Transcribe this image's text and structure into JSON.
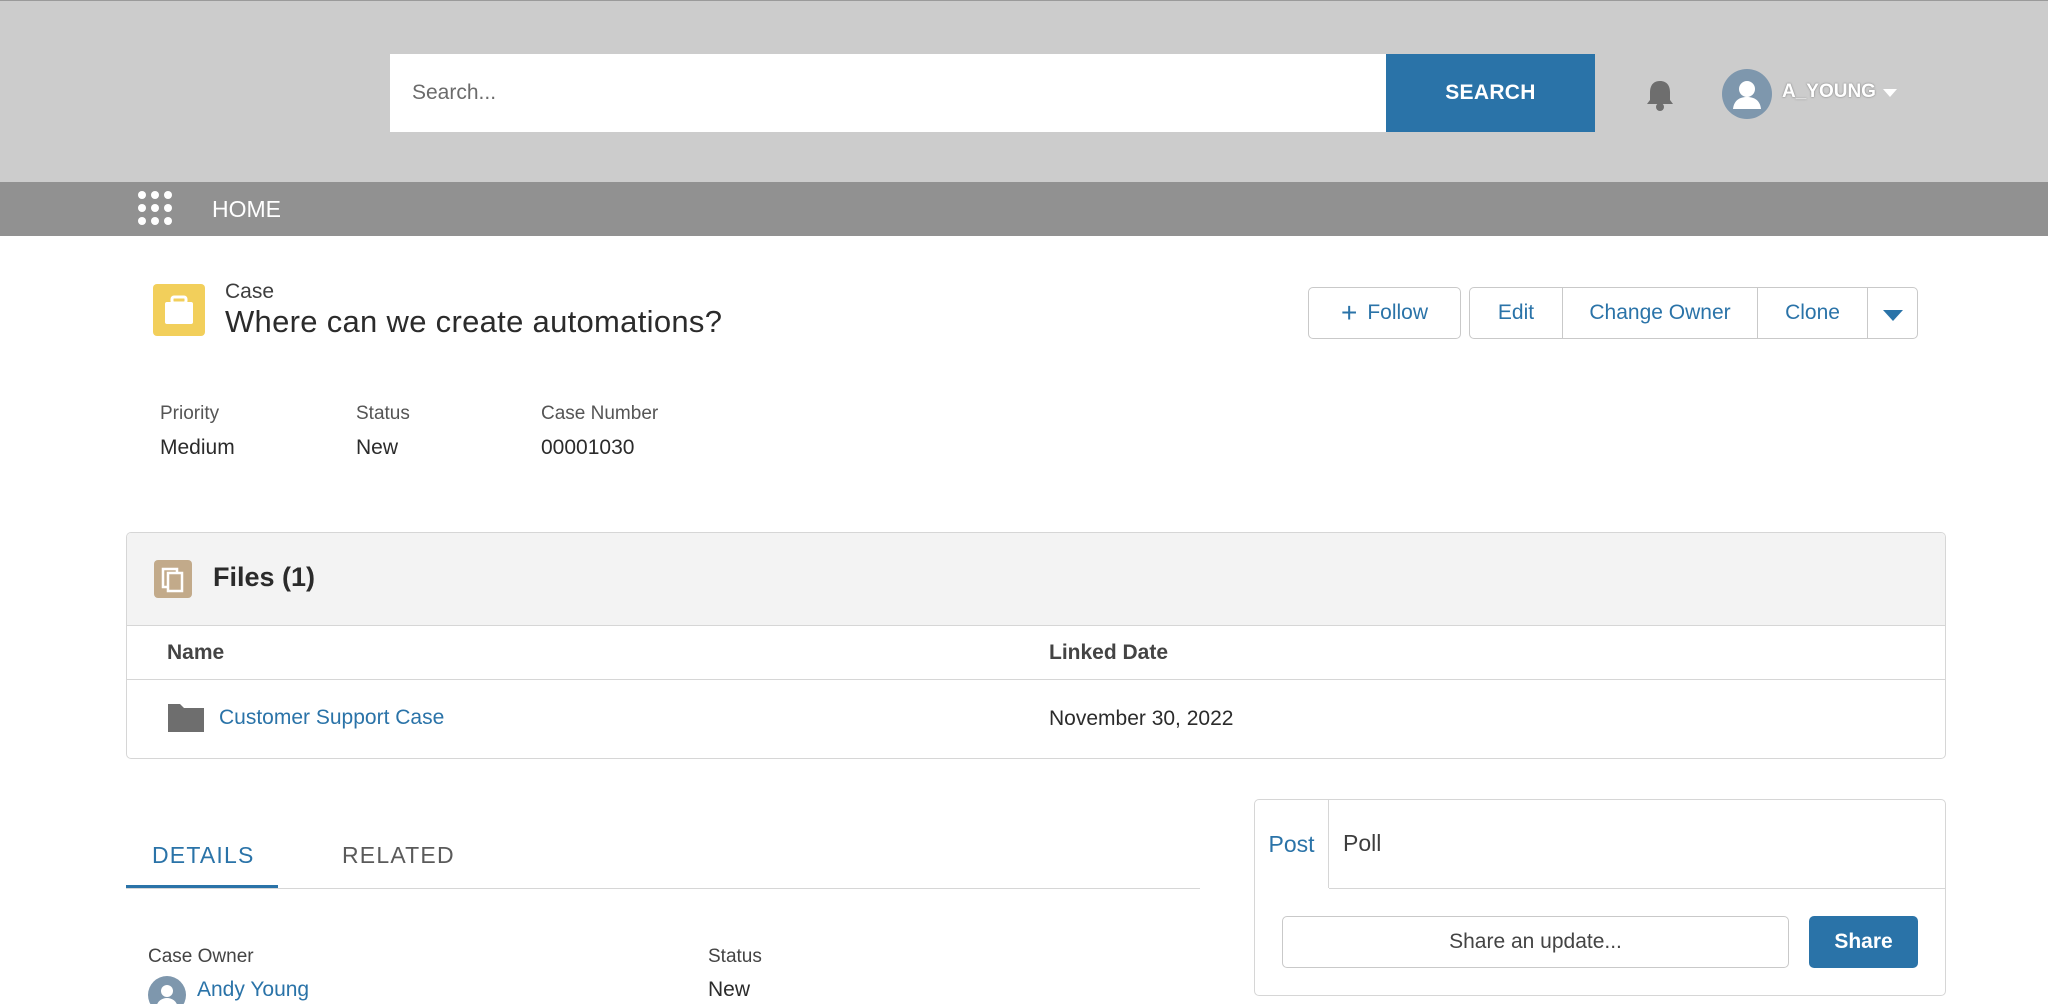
{
  "header": {
    "search_placeholder": "Search...",
    "search_button_label": "SEARCH",
    "bell_icon": "bell-icon",
    "username": "A_YOUNG"
  },
  "nav": {
    "home_label": "HOME"
  },
  "record": {
    "object_type": "Case",
    "title": "Where can we create automations?",
    "actions": {
      "follow": "Follow",
      "edit": "Edit",
      "change_owner": "Change Owner",
      "clone": "Clone"
    },
    "highlights": {
      "priority_label": "Priority",
      "priority_value": "Medium",
      "status_label": "Status",
      "status_value": "New",
      "case_number_label": "Case Number",
      "case_number_value": "00001030"
    }
  },
  "files": {
    "title": "Files (1)",
    "columns": [
      "Name",
      "Linked Date"
    ],
    "rows": [
      {
        "name": "Customer Support Case",
        "linked_date": "November 30, 2022"
      }
    ]
  },
  "tabs": {
    "details": "DETAILS",
    "related": "RELATED",
    "active": "DETAILS"
  },
  "details": {
    "case_owner_label": "Case Owner",
    "case_owner_value": "Andy Young",
    "status_label": "Status",
    "status_value": "New"
  },
  "publisher": {
    "post_tab": "Post",
    "poll_tab": "Poll",
    "share_placeholder": "Share an update...",
    "share_button": "Share"
  },
  "colors": {
    "accent": "#2a73a8",
    "header_bg": "#cccccc",
    "nav_bg": "#919191",
    "case_icon": "#f2cf5b",
    "files_icon": "#c2aa8a"
  }
}
